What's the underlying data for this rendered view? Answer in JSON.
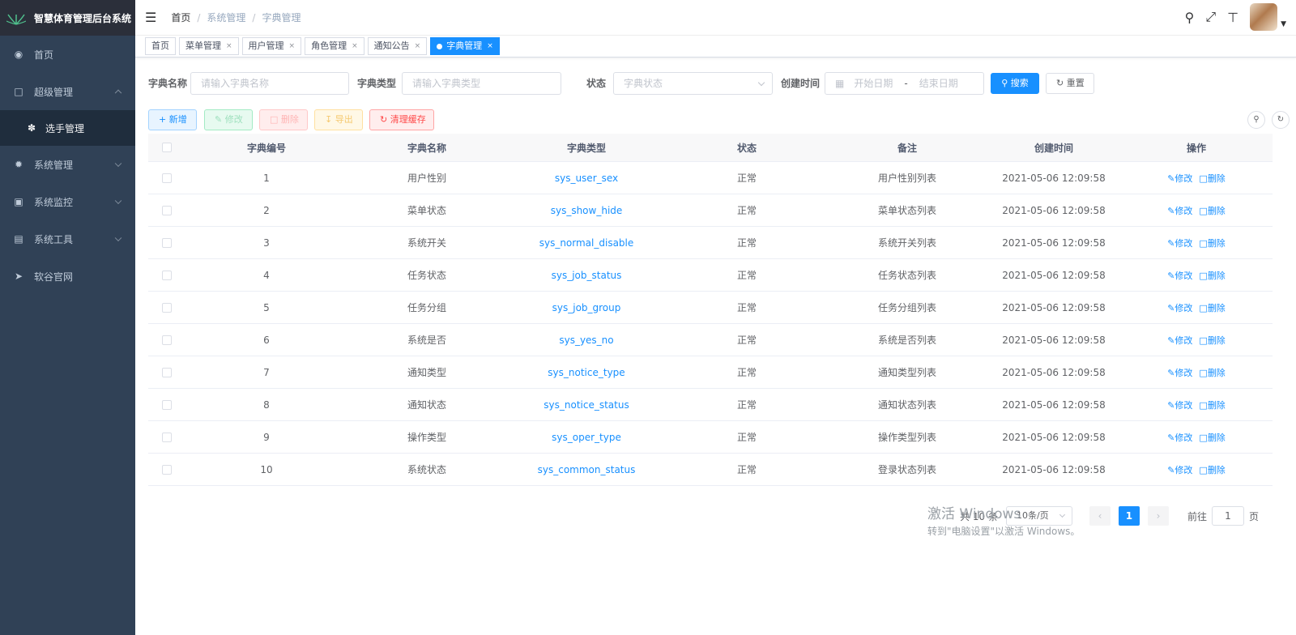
{
  "sidebar": {
    "title": "智慧体育管理后台系统",
    "items": [
      {
        "label": "首页",
        "icon": "dashboard-icon"
      },
      {
        "label": "超级管理",
        "icon": "bookmark-icon"
      },
      {
        "label": "选手管理",
        "icon": "bug-icon"
      },
      {
        "label": "系统管理",
        "icon": "gear-icon"
      },
      {
        "label": "系统监控",
        "icon": "monitor-icon"
      },
      {
        "label": "系统工具",
        "icon": "toolbox-icon"
      },
      {
        "label": "软谷官网",
        "icon": "send-icon"
      }
    ]
  },
  "header": {
    "breadcrumb": [
      "首页",
      "系统管理",
      "字典管理"
    ],
    "separator": "/"
  },
  "tags": [
    {
      "label": "首页",
      "closable": false
    },
    {
      "label": "菜单管理",
      "closable": true
    },
    {
      "label": "用户管理",
      "closable": true
    },
    {
      "label": "角色管理",
      "closable": true
    },
    {
      "label": "通知公告",
      "closable": true
    },
    {
      "label": "字典管理",
      "closable": true,
      "active": true
    }
  ],
  "search": {
    "dict_name_label": "字典名称",
    "dict_name_placeholder": "请输入字典名称",
    "dict_type_label": "字典类型",
    "dict_type_placeholder": "请输入字典类型",
    "status_label": "状态",
    "status_placeholder": "字典状态",
    "created_label": "创建时间",
    "start_placeholder": "开始日期",
    "range_sep": "-",
    "end_placeholder": "结束日期",
    "search_button": "搜索",
    "reset_button": "重置"
  },
  "toolbar": {
    "add": "新增",
    "edit": "修改",
    "delete": "删除",
    "export": "导出",
    "clear_cache": "清理缓存"
  },
  "table": {
    "columns": [
      "字典编号",
      "字典名称",
      "字典类型",
      "状态",
      "备注",
      "创建时间",
      "操作"
    ],
    "rows": [
      {
        "id": "1",
        "name": "用户性别",
        "type": "sys_user_sex",
        "status": "正常",
        "remark": "用户性别列表",
        "created": "2021-05-06 12:09:58"
      },
      {
        "id": "2",
        "name": "菜单状态",
        "type": "sys_show_hide",
        "status": "正常",
        "remark": "菜单状态列表",
        "created": "2021-05-06 12:09:58"
      },
      {
        "id": "3",
        "name": "系统开关",
        "type": "sys_normal_disable",
        "status": "正常",
        "remark": "系统开关列表",
        "created": "2021-05-06 12:09:58"
      },
      {
        "id": "4",
        "name": "任务状态",
        "type": "sys_job_status",
        "status": "正常",
        "remark": "任务状态列表",
        "created": "2021-05-06 12:09:58"
      },
      {
        "id": "5",
        "name": "任务分组",
        "type": "sys_job_group",
        "status": "正常",
        "remark": "任务分组列表",
        "created": "2021-05-06 12:09:58"
      },
      {
        "id": "6",
        "name": "系统是否",
        "type": "sys_yes_no",
        "status": "正常",
        "remark": "系统是否列表",
        "created": "2021-05-06 12:09:58"
      },
      {
        "id": "7",
        "name": "通知类型",
        "type": "sys_notice_type",
        "status": "正常",
        "remark": "通知类型列表",
        "created": "2021-05-06 12:09:58"
      },
      {
        "id": "8",
        "name": "通知状态",
        "type": "sys_notice_status",
        "status": "正常",
        "remark": "通知状态列表",
        "created": "2021-05-06 12:09:58"
      },
      {
        "id": "9",
        "name": "操作类型",
        "type": "sys_oper_type",
        "status": "正常",
        "remark": "操作类型列表",
        "created": "2021-05-06 12:09:58"
      },
      {
        "id": "10",
        "name": "系统状态",
        "type": "sys_common_status",
        "status": "正常",
        "remark": "登录状态列表",
        "created": "2021-05-06 12:09:58"
      }
    ],
    "op_edit": "修改",
    "op_delete": "删除"
  },
  "pagination": {
    "total": "共 10 条",
    "page_size": "10条/页",
    "current_page": "1",
    "goto_label": "前往",
    "goto_value": "1",
    "page_suffix": "页"
  },
  "watermark": {
    "title": "激活 Windows",
    "subtitle": "转到\"电脑设置\"以激活 Windows。"
  },
  "colors": {
    "sidebar_bg": "#304156",
    "primary": "#1890ff"
  }
}
